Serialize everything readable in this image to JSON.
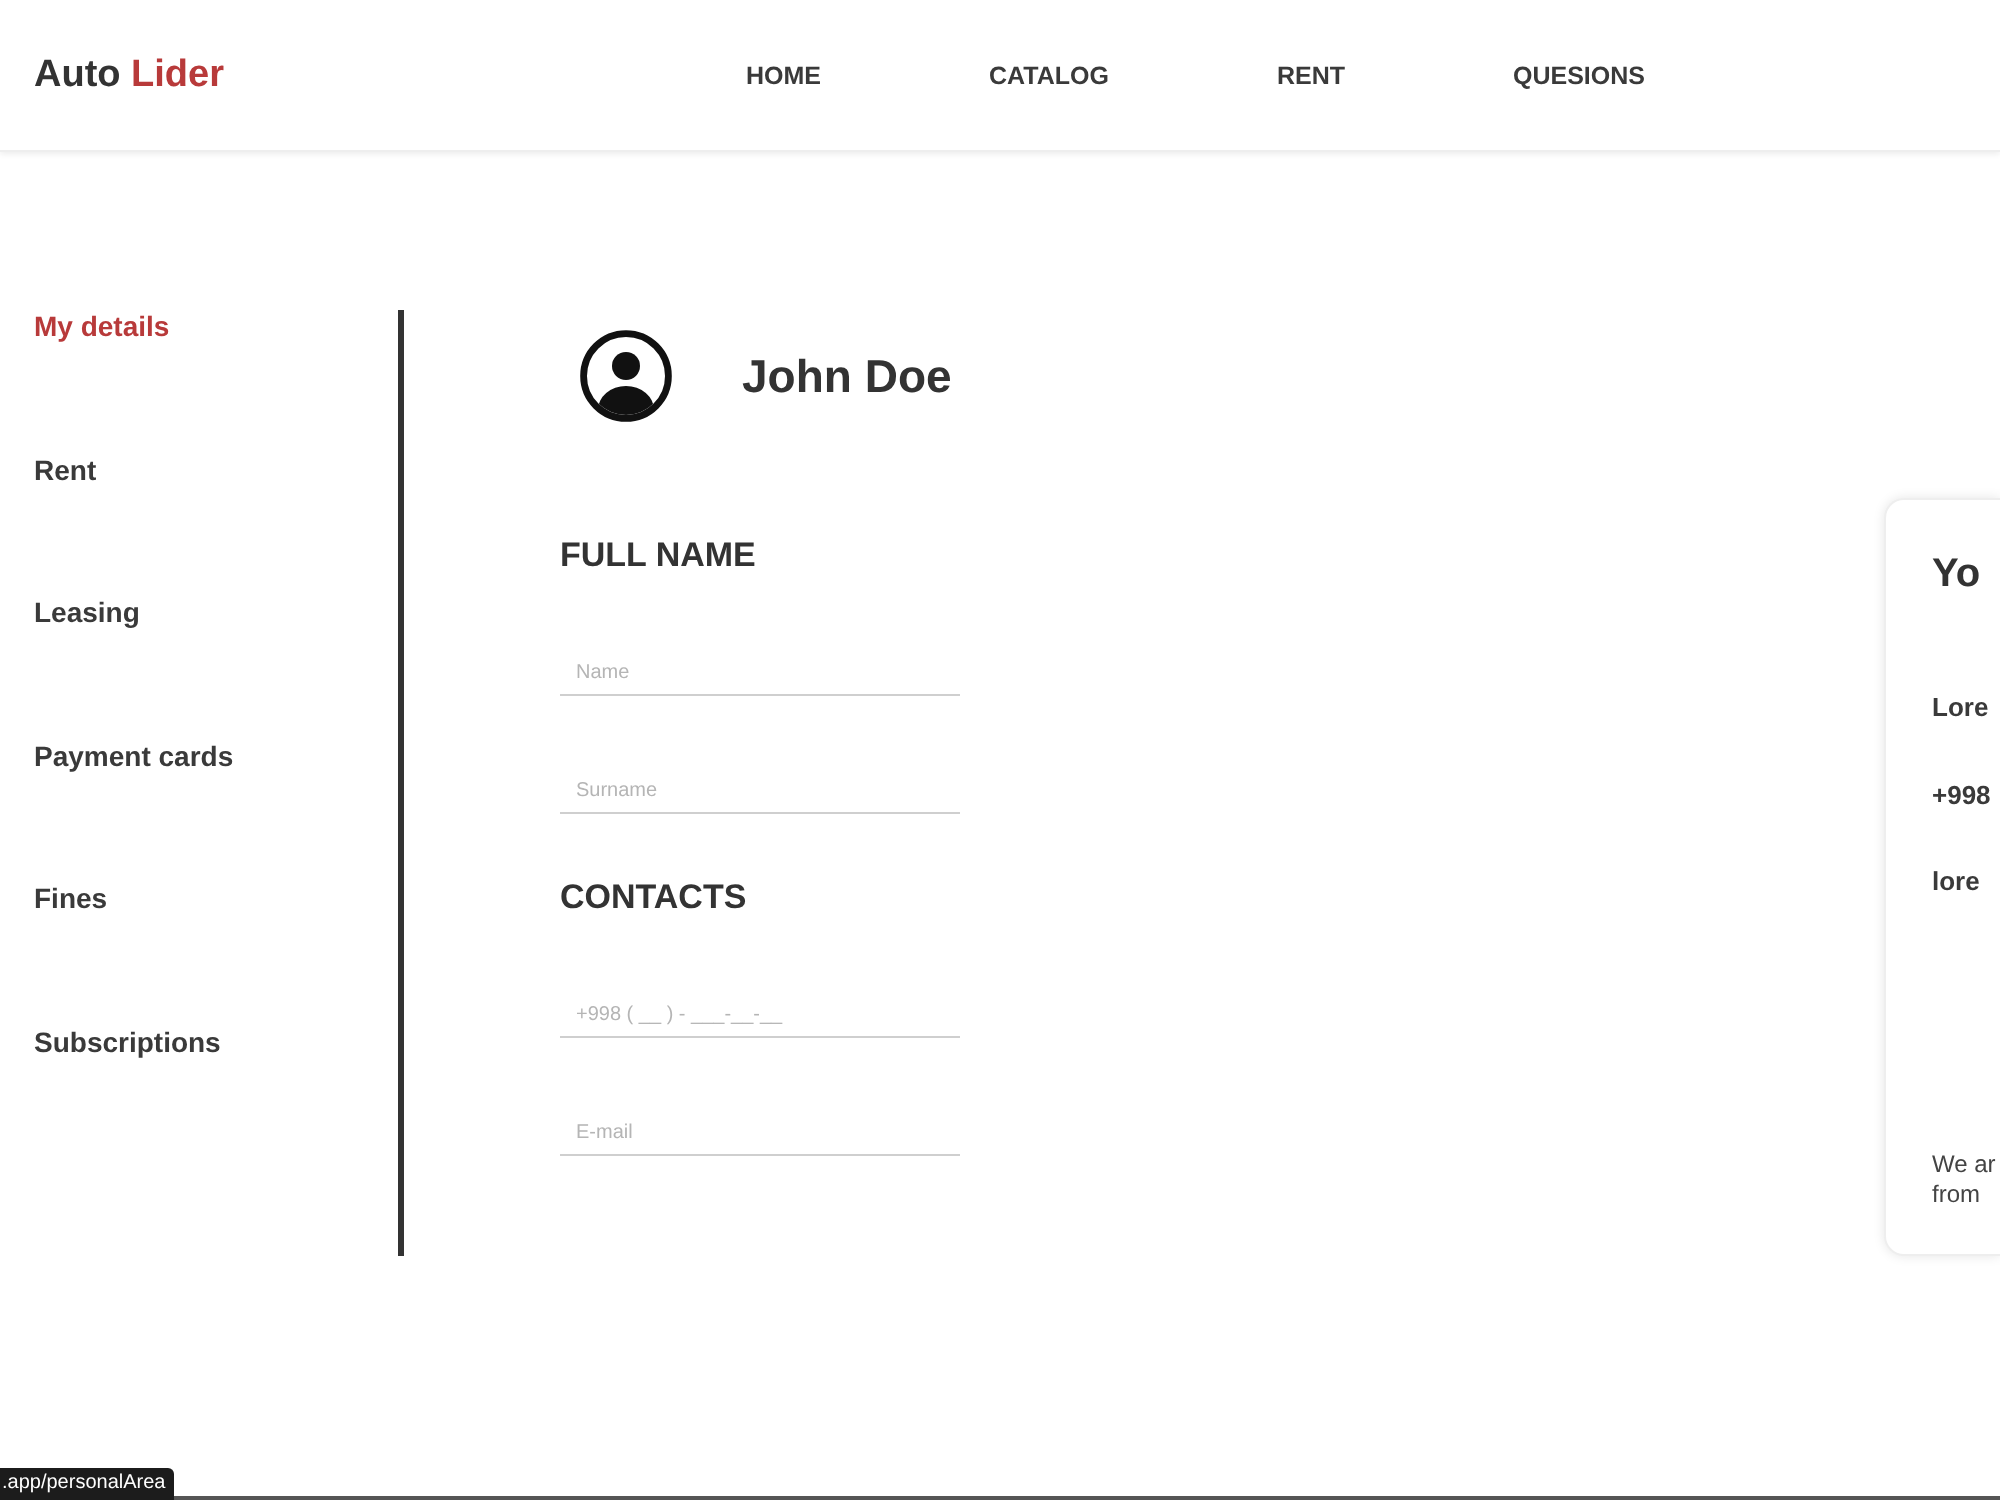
{
  "header": {
    "logo": {
      "text": "Auto",
      "accent": "Lider"
    },
    "nav": [
      {
        "label": "HOME"
      },
      {
        "label": "CATALOG"
      },
      {
        "label": "RENT"
      },
      {
        "label": "QUESIONS"
      }
    ]
  },
  "sidebar": {
    "items": [
      {
        "label": "My details",
        "selected": true
      },
      {
        "label": "Rent",
        "selected": false
      },
      {
        "label": "Leasing",
        "selected": false
      },
      {
        "label": "Payment cards",
        "selected": false
      },
      {
        "label": "Fines",
        "selected": false
      },
      {
        "label": "Subscriptions",
        "selected": false
      }
    ]
  },
  "profile": {
    "name": "John Doe"
  },
  "sections": [
    {
      "title": "FULL NAME",
      "fields": [
        {
          "placeholder": "Name"
        },
        {
          "placeholder": "Surname"
        }
      ]
    },
    {
      "title": "CONTACTS",
      "fields": [
        {
          "placeholder": "+998 ( __ ) - ___-__-__"
        },
        {
          "placeholder": "E-mail"
        }
      ]
    }
  ],
  "info_card": {
    "title": "Yo",
    "lines": [
      "Lore",
      "+998",
      "lore"
    ],
    "footer": [
      "We ar",
      "from"
    ]
  },
  "status_url": ".app/personalArea"
}
